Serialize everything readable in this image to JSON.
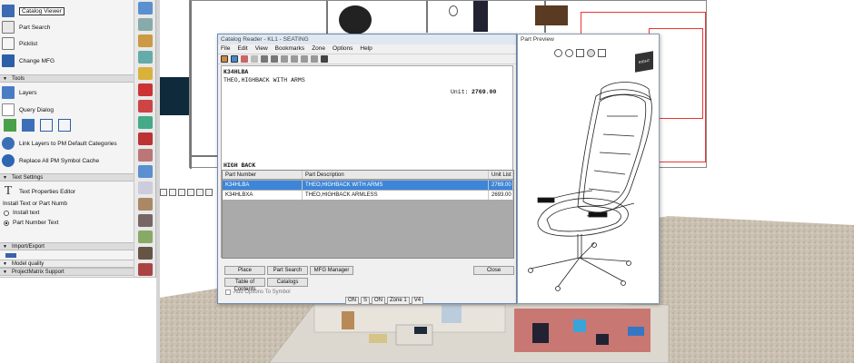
{
  "left_panel": {
    "items_top": [
      {
        "label": "Catalog Viewer",
        "icon": "catalog-viewer-icon",
        "active": true
      },
      {
        "label": "Part Search",
        "icon": "part-search-icon"
      },
      {
        "label": "Picklist",
        "icon": "picklist-icon"
      },
      {
        "label": "Change MFG",
        "icon": "change-mfg-icon"
      }
    ],
    "section_tools": "Tools",
    "tools_items": [
      {
        "label": "Layers",
        "icon": "layers-icon"
      },
      {
        "label": "Query Dialog",
        "icon": "query-dialog-icon"
      },
      {
        "label": "Link Layers to PM Default Categories",
        "icon": "link-layers-icon"
      },
      {
        "label": "Replace All PM Symbol Cache",
        "icon": "replace-cache-icon"
      }
    ],
    "section_text": "Text Settings",
    "text_items": {
      "properties": "Text Properties Editor",
      "install_label": "Install Text or Part Numb",
      "radio_install": "Install text",
      "radio_part": "Part Number Text"
    },
    "section_import": "Import/Export",
    "section_model": "Model quality",
    "section_pm": "ProjectMatrix Support"
  },
  "dialog": {
    "title": "Catalog Reader - KL1 - SEATING",
    "menu": [
      "File",
      "Edit",
      "View",
      "Bookmarks",
      "Zone",
      "Options",
      "Help"
    ],
    "part_code": "K34HLBA",
    "part_desc": "THEO,HIGHBACK WITH ARMS",
    "unit_label": "Unit:",
    "unit_value": "2769.00",
    "group_label": "HIGH BACK",
    "columns": [
      "Part Number",
      "Part Description",
      "Unit List"
    ],
    "rows": [
      {
        "part": "K34HLBA",
        "desc": "THEO,HIGHBACK WITH ARMS",
        "price": "2769.00",
        "selected": true
      },
      {
        "part": "K34HLBXA",
        "desc": "THEO,HIGHBACK ARMLESS",
        "price": "2693.00",
        "selected": false
      }
    ],
    "buttons": {
      "place": "Place",
      "part_search": "Part Search",
      "mfg_manager": "MFG Manager",
      "close": "Close",
      "toc": "Table of Contents",
      "catalogs": "Catalogs"
    },
    "add_options": "Add Options To Symbol",
    "status": {
      "on1": "ON",
      "s": "S",
      "on2": "ON",
      "zone": "Zone 1",
      "v4": "V4"
    }
  },
  "preview": {
    "title": "Part Preview",
    "cube_label": "RIGHT"
  }
}
